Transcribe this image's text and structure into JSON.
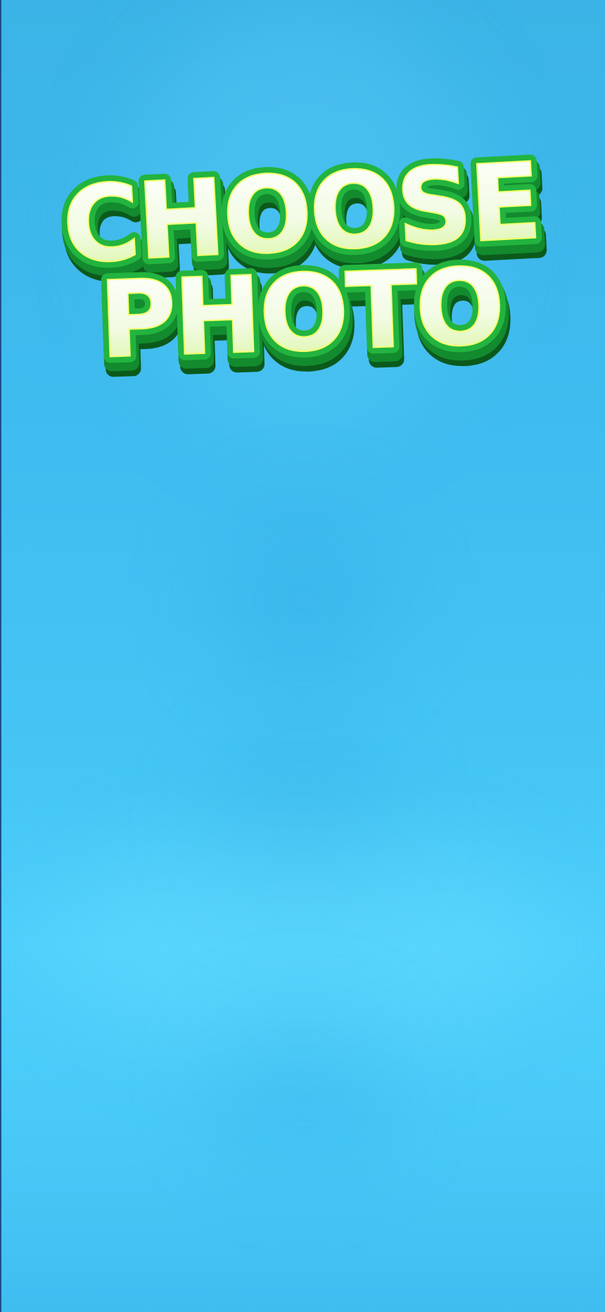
{
  "title": {
    "line1": "CHOOSE",
    "line2": "PHOTO"
  },
  "colors": {
    "background": "#3fbdf0",
    "title_fill_top": "#ffffff",
    "title_fill_bottom": "#d7f59a",
    "title_outline": "#1fa33a",
    "title_shadow": "#0d6a22"
  }
}
